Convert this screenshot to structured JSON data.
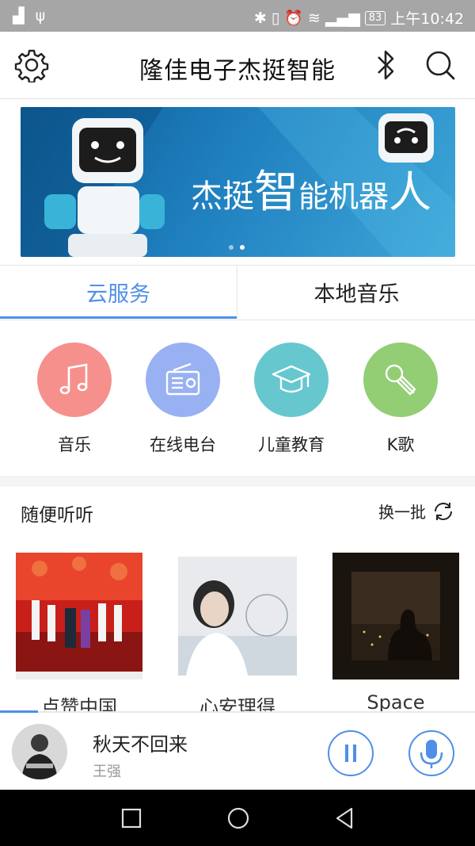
{
  "status_bar": {
    "time": "上午10:42",
    "battery": "83"
  },
  "header": {
    "title": "隆佳电子杰挺智能"
  },
  "banner": {
    "text_a": "杰挺",
    "text_b": "智",
    "text_c": "能机器",
    "text_d": "人"
  },
  "tabs": [
    {
      "label": "云服务",
      "active": true
    },
    {
      "label": "本地音乐",
      "active": false
    }
  ],
  "services": [
    {
      "label": "音乐",
      "color": "#f6908c",
      "icon": "music-note-icon"
    },
    {
      "label": "在线电台",
      "color": "#98b1f3",
      "icon": "radio-icon"
    },
    {
      "label": "儿童教育",
      "color": "#66c7cf",
      "icon": "graduation-cap-icon"
    },
    {
      "label": "K歌",
      "color": "#93cd74",
      "icon": "microphone-icon"
    }
  ],
  "section": {
    "title": "随便听听",
    "refresh_label": "换一批"
  },
  "albums": [
    {
      "title": "点赞中国"
    },
    {
      "title": "心安理得"
    },
    {
      "title": "Space"
    }
  ],
  "now_playing": {
    "song": "秋天不回来",
    "artist": "王强",
    "progress": 0.08
  },
  "colors": {
    "accent": "#4f8fe8",
    "album2_art_text": "心安理得"
  }
}
